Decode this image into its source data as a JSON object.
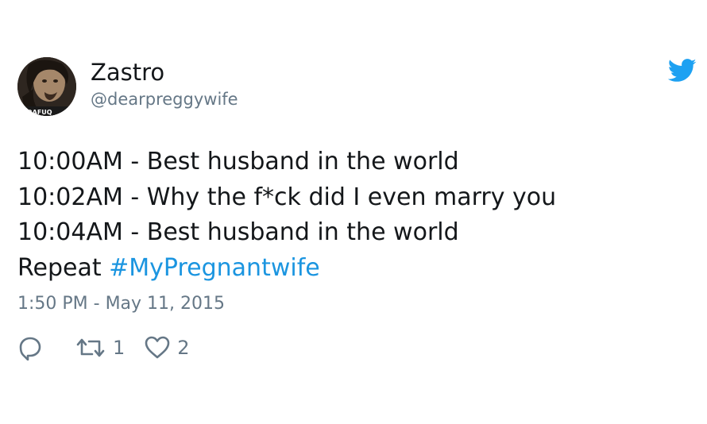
{
  "author": {
    "display_name": "Zastro",
    "handle": "@dearpreggywife",
    "avatar_caption": "DAFUQ"
  },
  "tweet": {
    "lines": [
      "10:00AM - Best husband in the world",
      "10:02AM - Why the f*ck did I even marry you",
      "10:04AM - Best husband in the world"
    ],
    "last_line_prefix": "Repeat ",
    "hashtag": "#MyPregnantwife",
    "timestamp": "1:50 PM - May 11, 2015"
  },
  "actions": {
    "reply_icon": "reply-icon",
    "retweet_icon": "retweet-icon",
    "retweet_count": "1",
    "like_icon": "heart-icon",
    "like_count": "2"
  },
  "colors": {
    "text": "#14171a",
    "secondary": "#657786",
    "hashtag": "#1b95e0",
    "twitter_blue": "#1da1f2"
  }
}
